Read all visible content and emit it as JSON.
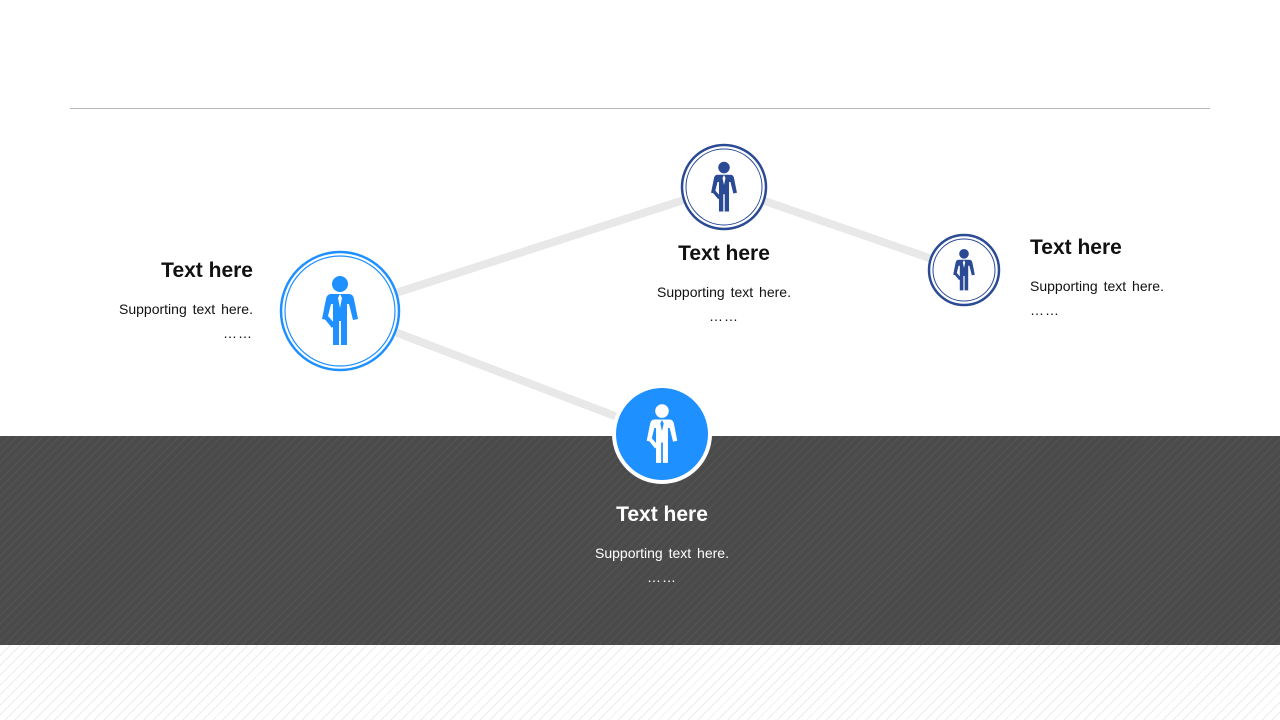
{
  "nodes": [
    {
      "title": "Text here",
      "support": "Supporting  text here.",
      "dots": "……"
    },
    {
      "title": "Text here",
      "support": "Supporting  text here.",
      "dots": "……"
    },
    {
      "title": "Text here",
      "support": "Supporting  text here.",
      "dots": "……"
    },
    {
      "title": "Text here",
      "support": "Supporting  text here.",
      "dots": "……"
    }
  ],
  "colors": {
    "accent": "#1e90ff",
    "navy": "#2a4a94",
    "connector": "#e8e8e8",
    "band": "#4a4a4a"
  },
  "icons": [
    "person-icon",
    "person-icon",
    "person-icon",
    "person-icon"
  ]
}
